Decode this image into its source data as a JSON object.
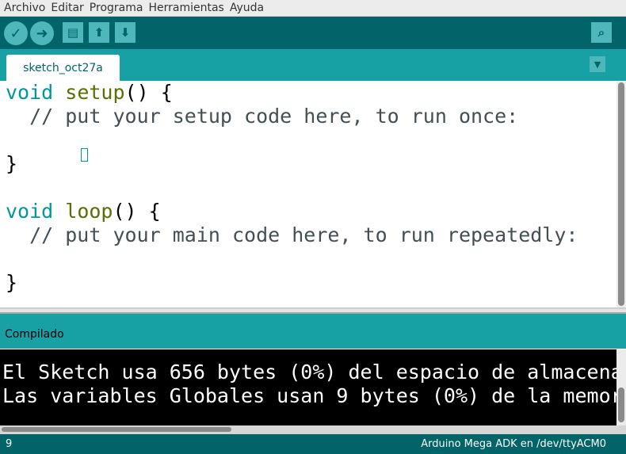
{
  "menu": [
    "Archivo",
    "Editar",
    "Programa",
    "Herramientas",
    "Ayuda"
  ],
  "toolbar": {
    "verify": "✓",
    "upload": "➜",
    "new": "▤",
    "open": "⬆",
    "save": "⬇",
    "serial": "⌕"
  },
  "tab": {
    "label": "sketch_oct27a",
    "menu_arrow": "▼"
  },
  "editor": {
    "l1_kw": "void",
    "l1_fn": "setup",
    "l1_rest": "() {",
    "l2": "  // put your setup code here, to run once:",
    "l4": "}",
    "l6_kw": "void",
    "l6_fn": "loop",
    "l6_rest": "() {",
    "l7": "  // put your main code here, to run repeatedly:",
    "l9": "}"
  },
  "console": {
    "status": "Compilado",
    "lines": [
      "El Sketch usa 656 bytes (0%) del espacio de almacena",
      "Las variables Globales usan 9 bytes (0%) de la memor"
    ]
  },
  "statusbar": {
    "line": "9",
    "board": "Arduino Mega ADK en /dev/ttyACM0"
  }
}
